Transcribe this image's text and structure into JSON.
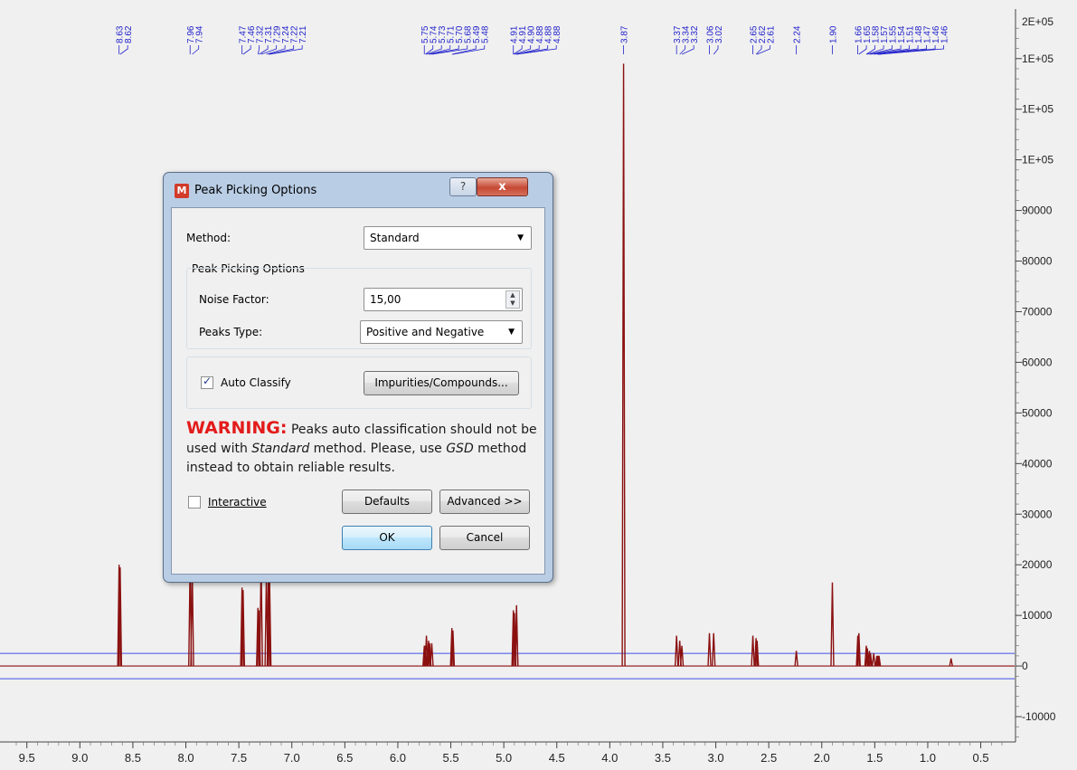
{
  "chart_data": {
    "type": "line",
    "title": "",
    "xlabel": "",
    "ylabel": "",
    "xlim": [
      9.6,
      0.3
    ],
    "ylim": [
      -15000,
      128000
    ],
    "x_ticks": [
      "9.5",
      "9.0",
      "8.5",
      "8.0",
      "7.5",
      "7.0",
      "6.5",
      "6.0",
      "5.5",
      "5.0",
      "4.5",
      "4.0",
      "3.5",
      "3.0",
      "2.5",
      "2.0",
      "1.5",
      "1.0",
      "0.5"
    ],
    "y_ticks": [
      {
        "label": "-10000",
        "value": -10000
      },
      {
        "label": "0",
        "value": 0
      },
      {
        "label": "10000",
        "value": 10000
      },
      {
        "label": "20000",
        "value": 20000
      },
      {
        "label": "30000",
        "value": 30000
      },
      {
        "label": "40000",
        "value": 40000
      },
      {
        "label": "50000",
        "value": 50000
      },
      {
        "label": "60000",
        "value": 60000
      },
      {
        "label": "70000",
        "value": 70000
      },
      {
        "label": "80000",
        "value": 80000
      },
      {
        "label": "90000",
        "value": 90000
      },
      {
        "label": "1E+05",
        "value": 100000
      },
      {
        "label": "1E+05",
        "value": 110000
      },
      {
        "label": "1E+05",
        "value": 120000
      }
    ],
    "top_right_label": "2E+05",
    "threshold_lines": [
      2500,
      -2500
    ],
    "peaks": [
      {
        "x": 8.63,
        "y": 20000
      },
      {
        "x": 8.62,
        "y": 19500
      },
      {
        "x": 7.96,
        "y": 20000
      },
      {
        "x": 7.94,
        "y": 19500
      },
      {
        "x": 7.47,
        "y": 15500
      },
      {
        "x": 7.46,
        "y": 15000
      },
      {
        "x": 7.32,
        "y": 11500
      },
      {
        "x": 7.31,
        "y": 11000
      },
      {
        "x": 7.29,
        "y": 21000
      },
      {
        "x": 7.24,
        "y": 18000
      },
      {
        "x": 7.22,
        "y": 19000
      },
      {
        "x": 7.21,
        "y": 17000
      },
      {
        "x": 5.75,
        "y": 4000
      },
      {
        "x": 5.74,
        "y": 4000
      },
      {
        "x": 5.73,
        "y": 6000
      },
      {
        "x": 5.71,
        "y": 5000
      },
      {
        "x": 5.7,
        "y": 4500
      },
      {
        "x": 5.68,
        "y": 4500
      },
      {
        "x": 5.49,
        "y": 7500
      },
      {
        "x": 5.48,
        "y": 7000
      },
      {
        "x": 4.91,
        "y": 11000
      },
      {
        "x": 4.9,
        "y": 10500
      },
      {
        "x": 4.88,
        "y": 12000
      },
      {
        "x": 4.88,
        "y": 9000
      },
      {
        "x": 3.87,
        "y": 119000
      },
      {
        "x": 3.37,
        "y": 6000
      },
      {
        "x": 3.34,
        "y": 5000
      },
      {
        "x": 3.32,
        "y": 4000
      },
      {
        "x": 3.06,
        "y": 6500
      },
      {
        "x": 3.02,
        "y": 6500
      },
      {
        "x": 2.65,
        "y": 6000
      },
      {
        "x": 2.62,
        "y": 5500
      },
      {
        "x": 2.61,
        "y": 5000
      },
      {
        "x": 2.24,
        "y": 3000
      },
      {
        "x": 1.9,
        "y": 16500
      },
      {
        "x": 1.66,
        "y": 6000
      },
      {
        "x": 1.65,
        "y": 6500
      },
      {
        "x": 1.58,
        "y": 4000
      },
      {
        "x": 1.57,
        "y": 3500
      },
      {
        "x": 1.55,
        "y": 3000
      },
      {
        "x": 1.54,
        "y": 2500
      },
      {
        "x": 1.51,
        "y": 2500
      },
      {
        "x": 1.48,
        "y": 2000
      },
      {
        "x": 1.47,
        "y": 2000
      },
      {
        "x": 1.46,
        "y": 2000
      },
      {
        "x": 1.46,
        "y": 1800
      },
      {
        "x": 0.78,
        "y": 1500
      }
    ],
    "peak_labels": [
      "8.63",
      "8.62",
      "7.96",
      "7.94",
      "7.47",
      "7.46",
      "7.32",
      "7.31",
      "7.29",
      "7.24",
      "7.22",
      "7.21",
      "5.75",
      "5.74",
      "5.73",
      "5.71",
      "5.70",
      "5.68",
      "5.49",
      "5.48",
      "4.91",
      "4.91",
      "4.90",
      "4.88",
      "4.88",
      "4.88",
      "3.87",
      "3.37",
      "3.34",
      "3.32",
      "3.06",
      "3.02",
      "2.65",
      "2.62",
      "2.61",
      "2.24",
      "1.90",
      "1.66",
      "1.65",
      "1.58",
      "1.57",
      "1.55",
      "1.54",
      "1.51",
      "1.48",
      "1.47",
      "1.46",
      "1.46"
    ],
    "colors": {
      "spectrum": "#8b1010",
      "label": "#2222cc",
      "threshold": "#3f4fe8",
      "background": "#f0f0f0"
    }
  },
  "dialog": {
    "title": "Peak Picking Options",
    "help_button": "?",
    "close_button": "x",
    "method_label": "Method:",
    "method_value": "Standard",
    "group_title": "Peak Picking Options",
    "noise_factor_label": "Noise Factor:",
    "noise_factor_value": "15,00",
    "peaks_type_label": "Peaks Type:",
    "peaks_type_value": "Positive and Negative",
    "auto_classify_label": "Auto Classify",
    "auto_classify_checked": true,
    "impurities_button": "Impurities/Compounds...",
    "warning_word": "WARNING:",
    "warning_part1": " Peaks auto classification should not be used with ",
    "warning_standard": "Standard",
    "warning_part2": " method. Please, use ",
    "warning_gsd": "GSD",
    "warning_part3": " method instead to obtain reliable results.",
    "interactive_label": "Interactive",
    "interactive_checked": false,
    "defaults_button": "Defaults",
    "advanced_button": "Advanced >>",
    "ok_button": "OK",
    "cancel_button": "Cancel"
  }
}
